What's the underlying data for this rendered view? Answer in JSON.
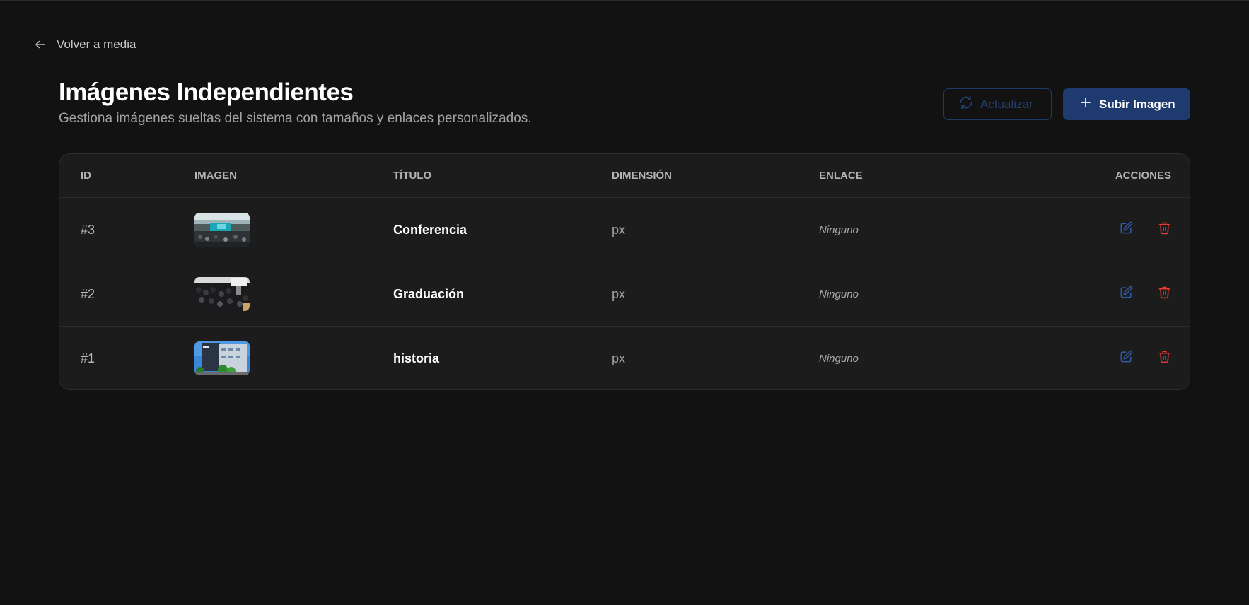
{
  "nav": {
    "back_label": "Volver a media"
  },
  "header": {
    "title": "Imágenes Independientes",
    "subtitle": "Gestiona imágenes sueltas del sistema con tamaños y enlaces personalizados."
  },
  "toolbar": {
    "refresh_label": "Actualizar",
    "upload_label": "Subir Imagen"
  },
  "table": {
    "columns": {
      "id": "ID",
      "image": "IMAGEN",
      "title": "TÍTULO",
      "dimension": "DIMENSIÓN",
      "link": "ENLACE",
      "actions": "ACCIONES"
    },
    "rows": [
      {
        "id": "#3",
        "title": "Conferencia",
        "dimension": "px",
        "link": "Ninguno",
        "thumbnail": "conference-hall-photo"
      },
      {
        "id": "#2",
        "title": "Graduación",
        "dimension": "px",
        "link": "Ninguno",
        "thumbnail": "graduation-crowd-photo"
      },
      {
        "id": "#1",
        "title": "historia",
        "dimension": "px",
        "link": "Ninguno",
        "thumbnail": "building-photo"
      }
    ]
  },
  "colors": {
    "background": "#121212",
    "card": "#1c1c1c",
    "primary": "#1e3a6e",
    "edit_icon": "#2e5aa8",
    "delete_icon": "#e53935"
  },
  "icons": {
    "back": "arrow-left-icon",
    "refresh": "refresh-icon",
    "upload": "plus-icon",
    "edit": "edit-icon",
    "delete": "trash-icon"
  }
}
